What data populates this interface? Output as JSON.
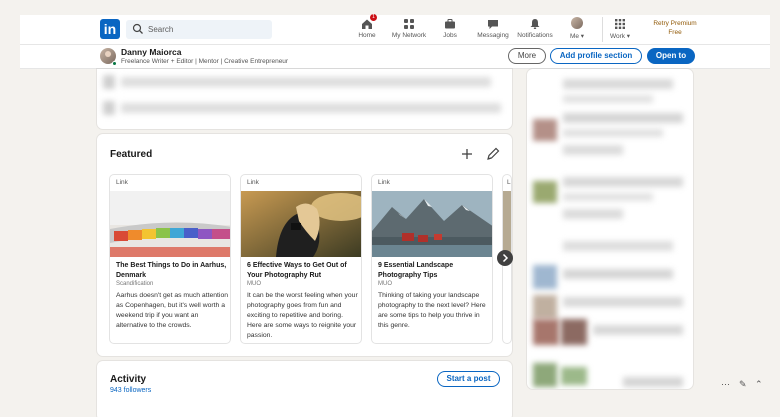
{
  "nav": {
    "logo": "in",
    "search_placeholder": "Search",
    "items": [
      {
        "label": "Home",
        "badge": "1"
      },
      {
        "label": "My Network"
      },
      {
        "label": "Jobs"
      },
      {
        "label": "Messaging"
      },
      {
        "label": "Notifications"
      },
      {
        "label": "Me ▾"
      },
      {
        "label": "Work ▾"
      }
    ],
    "premium_line1": "Retry Premium",
    "premium_line2": "Free"
  },
  "profile": {
    "name": "Danny Maiorca",
    "headline": "Freelance Writer + Editor | Mentor | Creative Entrepreneur",
    "btn_more": "More",
    "btn_add": "Add profile section",
    "btn_open": "Open to"
  },
  "featured": {
    "title": "Featured",
    "items": [
      {
        "type": "Link",
        "title": "The Best Things to Do in Aarhus, Denmark",
        "source": "Scandification",
        "desc": "Aarhus doesn't get as much attention as Copenhagen, but it's well worth a weekend trip if you want an alternative to the crowds."
      },
      {
        "type": "Link",
        "title": "6 Effective Ways to Get Out of Your Photography Rut",
        "source": "MUO",
        "desc": "It can be the worst feeling when your photography goes from fun and exciting to repetitive and boring. Here are some ways to reignite your passion."
      },
      {
        "type": "Link",
        "title": "9 Essential Landscape Photography Tips",
        "source": "MUO",
        "desc": "Thinking of taking your landscape photography to the next level? Here are some tips to help you thrive in this genre."
      },
      {
        "type": "L",
        "title": "",
        "source": "",
        "desc": ""
      }
    ]
  },
  "activity": {
    "title": "Activity",
    "followers": "943 followers",
    "btn_post": "Start a post"
  },
  "colors": {
    "brand": "#0a66c2",
    "background": "#f4f2ee",
    "premium": "#915907",
    "badge": "#cc1016"
  }
}
